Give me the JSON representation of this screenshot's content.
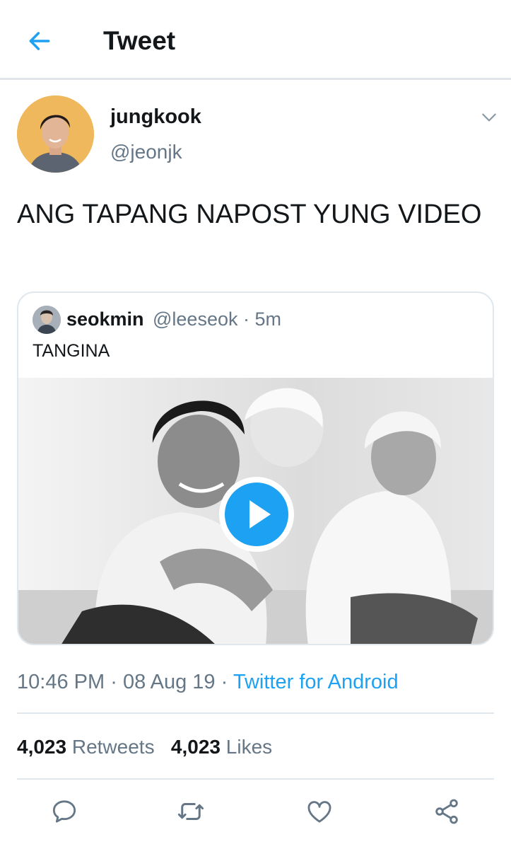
{
  "header": {
    "title": "Tweet",
    "back_icon": "arrow-left-icon"
  },
  "author": {
    "name": "jungkook",
    "handle": "@jeonjk",
    "menu_icon": "chevron-down-icon"
  },
  "tweet": {
    "text": "ANG TAPANG NAPOST YUNG VIDEO"
  },
  "quote": {
    "name": "seokmin",
    "meta": "@leeseok · 5m",
    "text": "TANGINA",
    "media_icon": "play-icon"
  },
  "meta": {
    "time": "10:46 PM",
    "sep1": "·",
    "date": "08 Aug 19",
    "sep2": "·",
    "source": "Twitter for Android"
  },
  "stats": {
    "retweets_count": "4,023",
    "retweets_label": "Retweets",
    "likes_count": "4,023",
    "likes_label": "Likes"
  },
  "actions": [
    "reply-icon",
    "retweet-icon",
    "like-icon",
    "share-icon"
  ],
  "colors": {
    "accent": "#1da1f2",
    "secondary_text": "#657786",
    "border": "#e1e8ed"
  }
}
